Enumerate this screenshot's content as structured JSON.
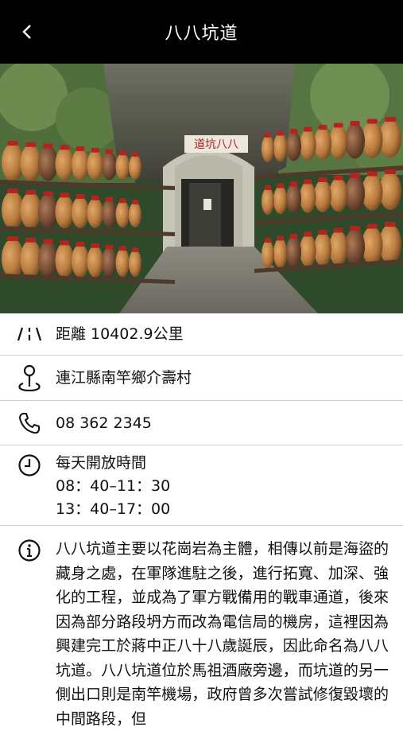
{
  "header": {
    "title": "八八坑道"
  },
  "hero": {
    "sign_text": "道坑八八"
  },
  "details": {
    "distance": "距離 10402.9公里",
    "address": "連江縣南竿鄉介壽村",
    "phone": "08 362 2345",
    "hours_title": "每天開放時間",
    "hours_line1": "08：40–11：30",
    "hours_line2": "13：40–17：00"
  },
  "description": "八八坑道主要以花崗岩為主體，相傳以前是海盜的藏身之處，在軍隊進駐之後，進行拓寬、加深、強化的工程，並成為了軍方戰備用的戰車通道，後來因為部分路段坍方而改為電信局的機房，這裡因為興建完工於蔣中正八十八歲誕辰，因此命名為八八坑道。八八坑道位於馬祖酒廠旁邊，而坑道的另一側出口則是南竿機場，政府曾多次嘗試修復毀壞的中間路段，但"
}
